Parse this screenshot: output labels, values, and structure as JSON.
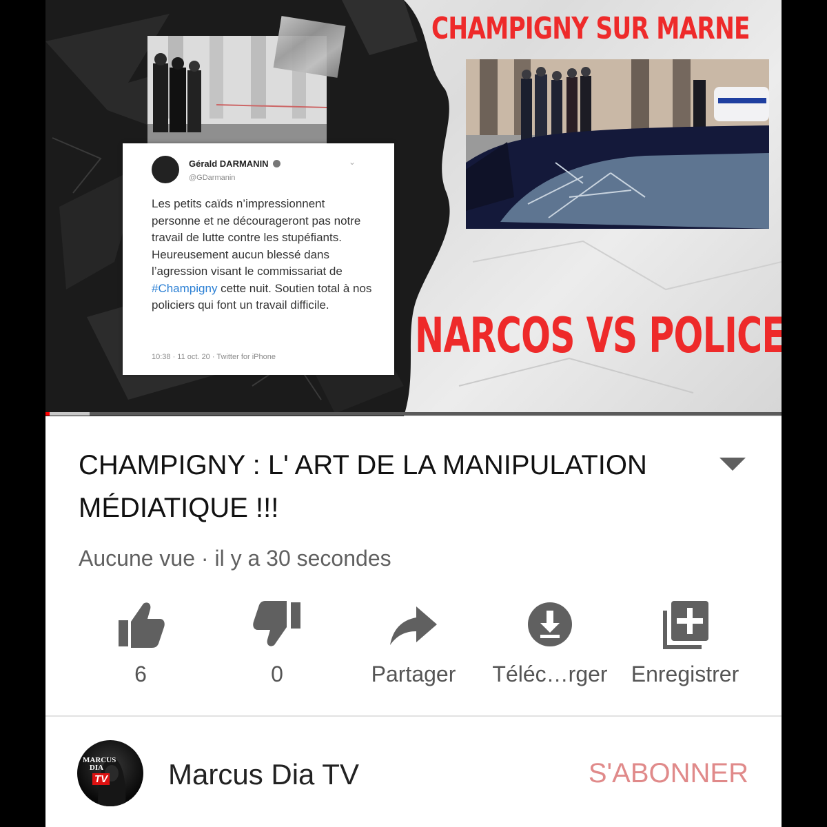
{
  "thumbnail": {
    "headline_top": "CHAMPIGNY SUR MARNE",
    "headline_bottom": "NARCOS VS POLICE",
    "tweet": {
      "author": "Gérald DARMANIN",
      "handle": "@GDarmanin",
      "text_before_tag": "Les petits caïds n’impressionnent personne et ne décourageront pas notre travail de lutte contre les stupéfiants. Heureusement aucun blessé dans l’agression visant le commissariat de ",
      "hashtag": "#Champigny",
      "text_after_tag": " cette nuit. Soutien total à nos policiers qui font un travail difficile.",
      "meta": "10:38 · 11 oct. 20 · Twitter for iPhone"
    },
    "progress": 0.06
  },
  "video": {
    "title": "CHAMPIGNY : L' ART DE LA MANIPULATION MÉDIATIQUE !!!",
    "meta": "Aucune vue · il y a 30 secondes"
  },
  "actions": [
    {
      "icon": "thumbs-up-icon",
      "label": "6"
    },
    {
      "icon": "thumbs-down-icon",
      "label": "0"
    },
    {
      "icon": "share-icon",
      "label": "Partager"
    },
    {
      "icon": "download-icon",
      "label": "Téléc…rger"
    },
    {
      "icon": "add-to-playlist-icon",
      "label": "Enregistrer"
    }
  ],
  "channel": {
    "name": "Marcus Dia TV",
    "logo_text_top": "MARCUS DIA",
    "logo_text_tv": "TV",
    "subscribe_label": "S'ABONNER"
  },
  "colors": {
    "headline_red": "#ee2a2a",
    "subscribe": "#e08a8a",
    "icon_grey": "#606060",
    "progress_red": "#ff0000"
  }
}
